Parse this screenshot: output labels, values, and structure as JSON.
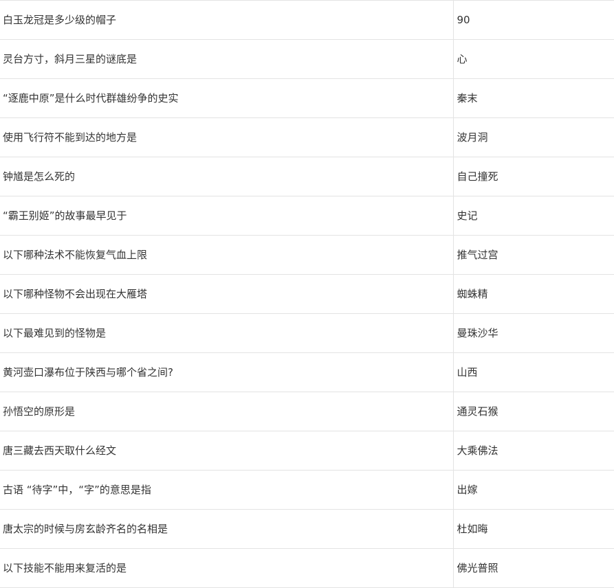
{
  "rows": [
    {
      "question": "白玉龙冠是多少级的帽子",
      "answer": "90"
    },
    {
      "question": "灵台方寸，斜月三星的谜底是",
      "answer": "心"
    },
    {
      "question": "“逐鹿中原”是什么时代群雄纷争的史实",
      "answer": "秦末"
    },
    {
      "question": "使用飞行符不能到达的地方是",
      "answer": "波月洞"
    },
    {
      "question": "钟馗是怎么死的",
      "answer": "自己撞死"
    },
    {
      "question": "“霸王别姬”的故事最早见于",
      "answer": "史记"
    },
    {
      "question": "以下哪种法术不能恢复气血上限",
      "answer": "推气过宫"
    },
    {
      "question": "以下哪种怪物不会出现在大雁塔",
      "answer": "蜘蛛精"
    },
    {
      "question": "以下最难见到的怪物是",
      "answer": "曼珠沙华"
    },
    {
      "question": "黄河壶口瀑布位于陕西与哪个省之间?",
      "answer": "山西"
    },
    {
      "question": "孙悟空的原形是",
      "answer": "通灵石猴"
    },
    {
      "question": "唐三藏去西天取什么经文",
      "answer": "大乘佛法"
    },
    {
      "question": "古语 “待字”中，“字”的意思是指",
      "answer": "出嫁"
    },
    {
      "question": "唐太宗的时候与房玄龄齐名的名相是",
      "answer": "杜如晦"
    },
    {
      "question": "以下技能不能用来复活的是",
      "answer": "佛光普照"
    }
  ]
}
